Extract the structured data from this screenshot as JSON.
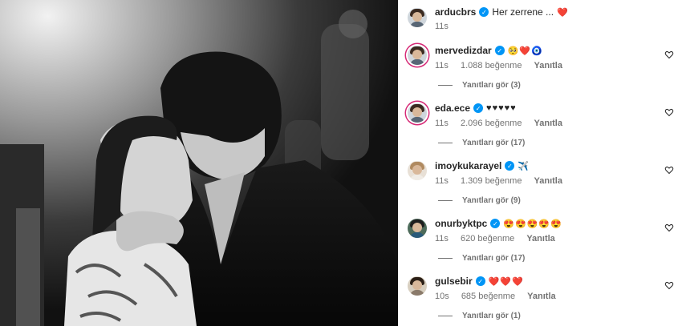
{
  "post": {
    "author": "arducbrs",
    "caption": "Her zerrene ...",
    "caption_emoji": "❤️",
    "time": "11s"
  },
  "comments": [
    {
      "user": "mervedizdar",
      "text": "🥺❤️🧿",
      "time": "11s",
      "likes": "1.088 beğenme",
      "reply": "Yanıtla",
      "replies": "Yanıtları gör (3)"
    },
    {
      "user": "eda.ece",
      "text": "♥♥♥♥♥",
      "time": "11s",
      "likes": "2.096 beğenme",
      "reply": "Yanıtla",
      "replies": "Yanıtları gör (17)"
    },
    {
      "user": "imoykukarayel",
      "text": "✈️",
      "time": "11s",
      "likes": "1.309 beğenme",
      "reply": "Yanıtla",
      "replies": "Yanıtları gör (9)"
    },
    {
      "user": "onurbyktpc",
      "text": "😍😍😍😍😍",
      "time": "11s",
      "likes": "620 beğenme",
      "reply": "Yanıtla",
      "replies": "Yanıtları gör (17)"
    },
    {
      "user": "gulsebir",
      "text": "❤️❤️❤️",
      "time": "10s",
      "likes": "685 beğenme",
      "reply": "Yanıtla",
      "replies": "Yanıtları gör (1)"
    }
  ],
  "colors": {
    "verified": "#0095f6",
    "heart": "#ed4956",
    "meta": "#737373"
  }
}
